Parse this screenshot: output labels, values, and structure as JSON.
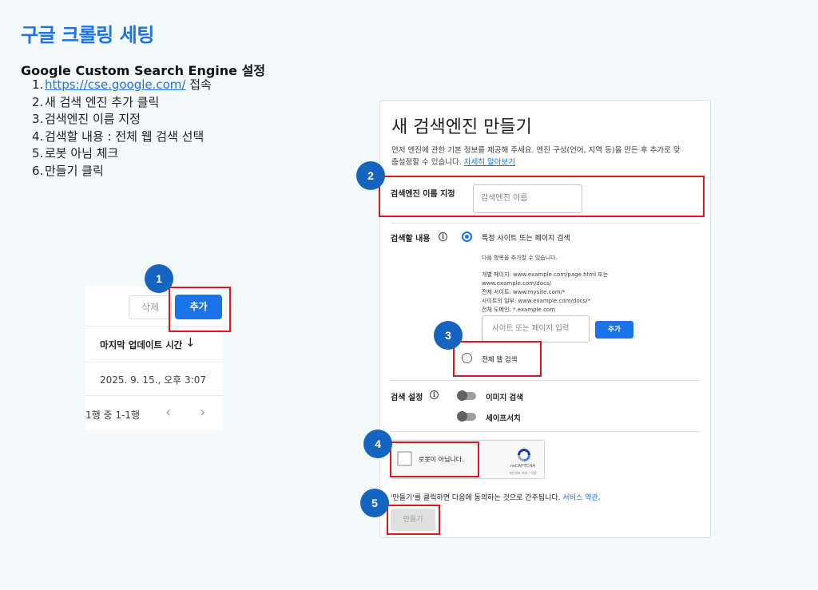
{
  "title": "구글 크롤링 세팅",
  "subtitle": "Google Custom Search Engine 설정",
  "steps": [
    {
      "num": "1.",
      "link": "https://cse.google.com/",
      "text": " 접속"
    },
    {
      "num": "2.",
      "text": "새 검색 엔진 추가 클릭"
    },
    {
      "num": "3.",
      "text": "검색엔진 이름 지정"
    },
    {
      "num": "4.",
      "text": "검색할 내용 : 전체 웹 검색 선택"
    },
    {
      "num": "5.",
      "text": "로봇 아님 체크"
    },
    {
      "num": "6.",
      "text": "만들기 클릭"
    }
  ],
  "left_panel": {
    "delete_label": "삭제",
    "add_label": "추가",
    "column_header": "마지막 업데이트 시간",
    "row_value": "2025. 9. 15., 오후 3:07",
    "pager": "1행 중 1-1행"
  },
  "card": {
    "title": "새 검색엔진 만들기",
    "desc_line1": "먼저 엔진에 관한 기본 정보를 제공해 주세요. 엔진 구성(언어, 지역 등)을 만든 후 추가로 맞",
    "desc_line2": "춤설정할 수 있습니다. ",
    "desc_link": "자세히 알아보기",
    "name_label": "검색엔진 이름 지정",
    "name_placeholder": "검색엔진 이름",
    "scope_label": "검색할 내용",
    "radio_specific": "특정 사이트 또는 페이지 검색",
    "hint": "다음 항목을 추가할 수 있습니다.",
    "examples": [
      "개별 페이지: www.example.com/page.html 또는",
      "www.example.com/docs/",
      "전체 사이트: www.mysite.com/*",
      "사이트의 일부: www.example.com/docs/*",
      "전체 도메인: *.example.com"
    ],
    "site_placeholder": "사이트 또는 페이지 입력",
    "add_site_label": "추가",
    "radio_all": "전체 웹 검색",
    "settings_label": "검색 설정",
    "toggle_image": "이미지 검색",
    "toggle_safe": "세이프서치",
    "captcha_label": "로봇이 아닙니다.",
    "recaptcha_brand": "reCAPTCHA",
    "recaptcha_terms": "개인정보 보호 - 약관",
    "agree_text": "'만들기'를 클릭하면 다음에 동의하는 것으로 간주됩니다. ",
    "agree_link": "서비스 약관",
    "agree_end": ".",
    "create_label": "만들기"
  },
  "badges": [
    "1",
    "2",
    "3",
    "4",
    "5"
  ],
  "colors": {
    "accent": "#1a73e8",
    "highlight": "#e0161c",
    "badge": "#1565c0"
  }
}
